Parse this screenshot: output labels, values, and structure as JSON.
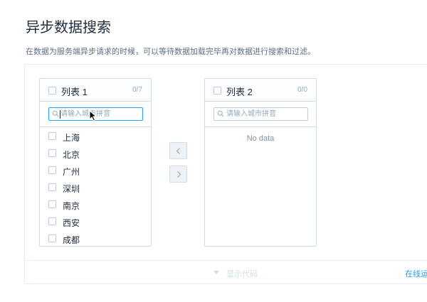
{
  "page": {
    "title": "异步数据搜索",
    "description": "在数据为服务端异步请求的时候，可以等待数据加载完毕再对数据进行搜索和过滤。"
  },
  "transfer": {
    "left": {
      "title": "列表 1",
      "count": "0/7",
      "filter_placeholder": "请输入城市拼音",
      "items": [
        "上海",
        "北京",
        "广州",
        "深圳",
        "南京",
        "西安",
        "成都"
      ]
    },
    "right": {
      "title": "列表 2",
      "count": "0/0",
      "filter_placeholder": "请输入城市拼音",
      "empty_text": "No data"
    },
    "buttons": {
      "to_left_icon": "chevron-left-icon",
      "to_right_icon": "chevron-right-icon"
    }
  },
  "footer": {
    "show_code_label": "显示代码",
    "run_online_label": "在线运"
  },
  "colors": {
    "accent": "#20a0ff",
    "border": "#d1dbe5",
    "text": "#1f2d3d",
    "muted": "#97a8be"
  }
}
